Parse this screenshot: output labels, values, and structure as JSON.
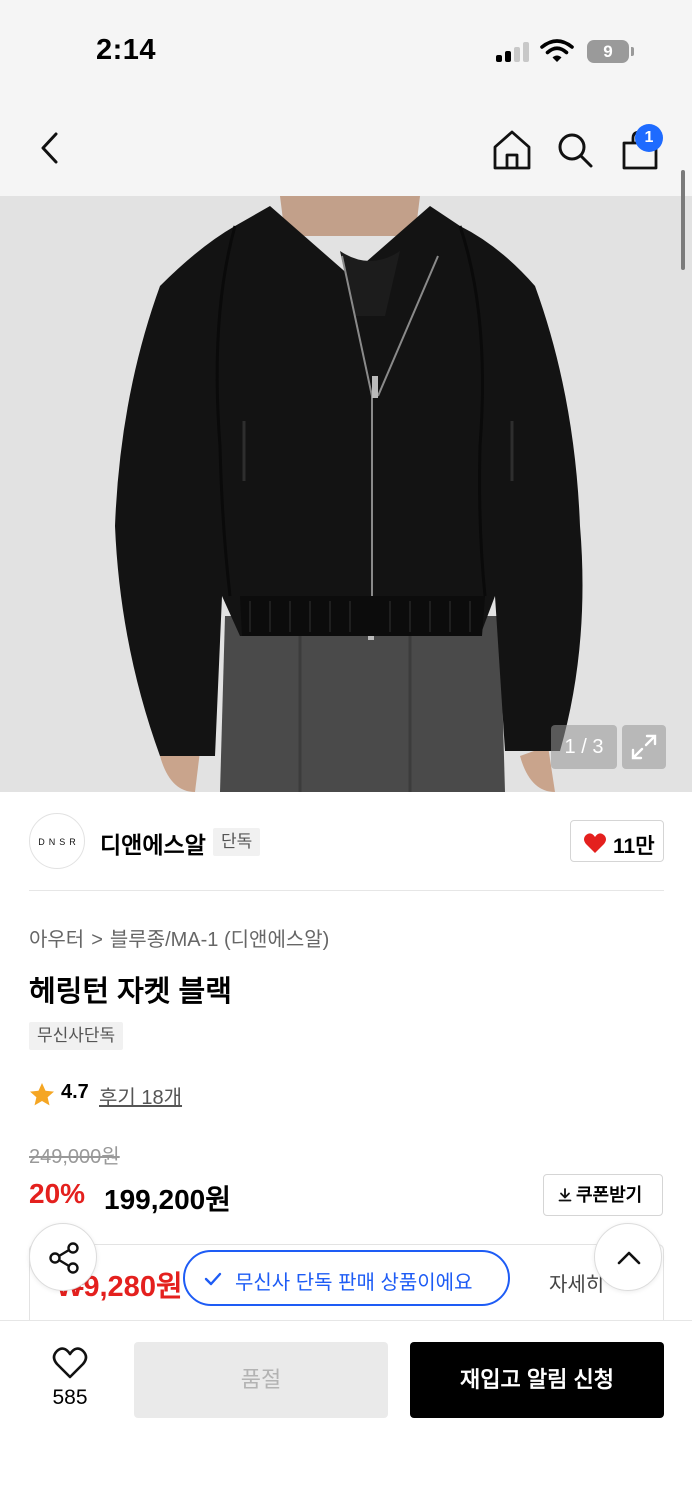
{
  "status_bar": {
    "time": "2:14",
    "battery": "9"
  },
  "nav": {
    "back_icon": "chevron-left-icon",
    "home_icon": "home-icon",
    "search_icon": "search-icon",
    "cart_icon": "shopping-bag-icon",
    "cart_badge": "1"
  },
  "gallery": {
    "counter": "1 / 3",
    "expand_icon": "expand-icon"
  },
  "brand": {
    "logo_text": "DNSR",
    "name": "디앤에스알",
    "tag": "단독",
    "like_count": "11만",
    "like_icon": "heart-filled-icon"
  },
  "product": {
    "breadcrumb": [
      "아우터",
      "블루종/MA-1 (디앤에스알)"
    ],
    "breadcrumb_sep": ">",
    "title": "헤링턴 자켓 블랙",
    "badge": "무신사단독",
    "rating": "4.7",
    "reviews": "후기 18개",
    "original_price": "249,000원",
    "discount": "20%",
    "sale_price": "199,200원",
    "coupon_label": "쿠폰받기",
    "member_price": "₩9,280원",
    "detail_link": "자세히"
  },
  "toast": {
    "text": "무신사 단독 판매 상품이에요"
  },
  "bottom": {
    "wish_count": "585",
    "soldout_label": "품절",
    "restock_label": "재입고 알림 신청"
  },
  "colors": {
    "accent_blue": "#1e5cf5",
    "sale_red": "#e4201e",
    "star": "#f5a623"
  }
}
